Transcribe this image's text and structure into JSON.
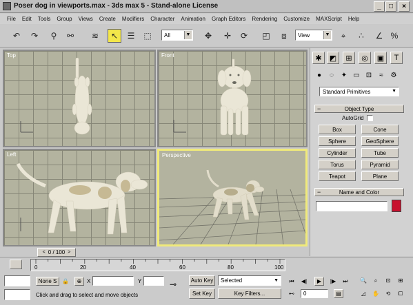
{
  "window": {
    "title": "Poser dog in viewports.max - 3ds max 5 - Stand-alone License",
    "minimize": "_",
    "maximize": "□",
    "close": "×"
  },
  "menu": [
    "File",
    "Edit",
    "Tools",
    "Group",
    "Views",
    "Create",
    "Modifiers",
    "Character",
    "Animation",
    "Graph Editors",
    "Rendering",
    "Customize",
    "MAXScript",
    "Help"
  ],
  "toolbar": {
    "selection_filter": "All",
    "reference_coord": "View"
  },
  "viewports": {
    "top": "Top",
    "front": "Front",
    "left": "Left",
    "perspective": "Perspective"
  },
  "command_panel": {
    "category_dropdown": "Standard Primitives",
    "object_type_title": "Object Type",
    "autogrid_label": "AutoGrid",
    "buttons": [
      "Box",
      "Cone",
      "Sphere",
      "GeoSphere",
      "Cylinder",
      "Tube",
      "Torus",
      "Pyramid",
      "Teapot",
      "Plane"
    ],
    "name_color_title": "Name and Color",
    "name_value": "",
    "color": "#c8102e"
  },
  "timeline": {
    "frame_counter": "0 / 100",
    "ticks": [
      "0",
      "20",
      "40",
      "60",
      "80",
      "100"
    ],
    "frames_max": 100,
    "current_frame": 0
  },
  "status": {
    "selection_lock": "None S",
    "x_label": "X",
    "y_label": "Y",
    "auto_key": "Auto Key",
    "set_key": "Set Key",
    "selected_dropdown": "Selected",
    "key_filters": "Key Filters...",
    "current_frame_field": "0",
    "prompt": "Click and drag to select and move objects"
  },
  "colors": {
    "active_viewport_border": "#f0ea7a",
    "viewport_bg": "#b3b39f",
    "dog_fill": "#eae6d6"
  }
}
